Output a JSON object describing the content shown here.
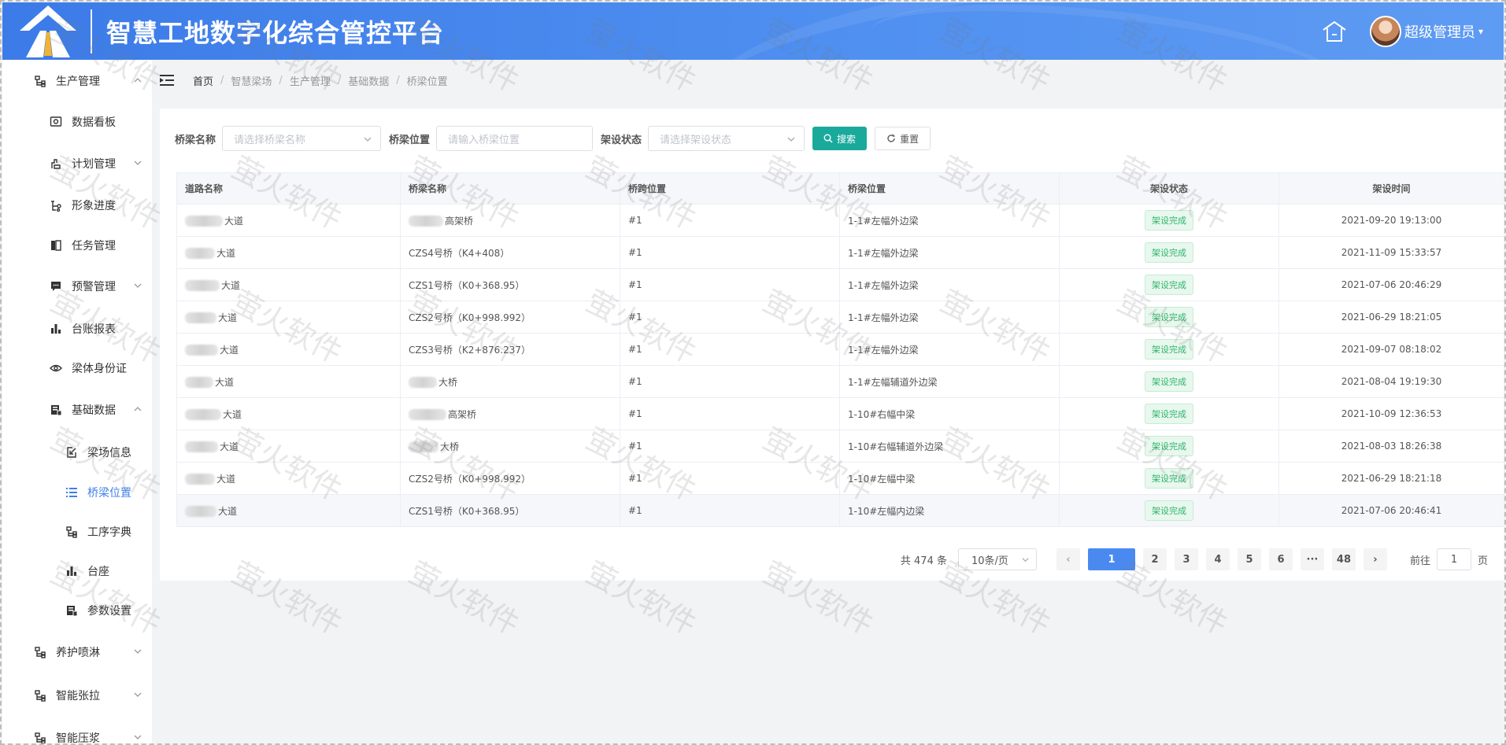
{
  "header": {
    "app_title": "智慧工地数字化综合管控平台",
    "username": "超级管理员",
    "icons": [
      "logo-road-icon",
      "home-icon",
      "caret-down-icon"
    ]
  },
  "sidebar": {
    "items": [
      {
        "label": "生产管理",
        "icon": "tree-icon"
      },
      {
        "label": "数据看板",
        "icon": "dashboard-icon"
      },
      {
        "label": "计划管理",
        "icon": "plan-icon"
      },
      {
        "label": "形象进度",
        "icon": "progress-icon"
      },
      {
        "label": "任务管理",
        "icon": "task-icon"
      },
      {
        "label": "预警管理",
        "icon": "alert-icon"
      },
      {
        "label": "台账报表",
        "icon": "chart-icon"
      },
      {
        "label": "梁体身份证",
        "icon": "eye-icon"
      },
      {
        "label": "基础数据",
        "icon": "database-icon"
      },
      {
        "label": "梁场信息",
        "icon": "info-icon"
      },
      {
        "label": "桥梁位置",
        "icon": "list-icon"
      },
      {
        "label": "工序字典",
        "icon": "tree-icon"
      },
      {
        "label": "台座",
        "icon": "chart-icon"
      },
      {
        "label": "参数设置",
        "icon": "settings-icon"
      },
      {
        "label": "养护喷淋",
        "icon": "tree-icon"
      },
      {
        "label": "智能张拉",
        "icon": "tree-icon"
      },
      {
        "label": "智能压浆",
        "icon": "tree-icon"
      }
    ]
  },
  "breadcrumb": {
    "items": [
      "首页",
      "智慧梁场",
      "生产管理",
      "基础数据",
      "桥梁位置"
    ],
    "separator": "/"
  },
  "filters": {
    "bridge_name_label": "桥梁名称",
    "bridge_name_placeholder": "请选择桥梁名称",
    "bridge_position_label": "桥梁位置",
    "bridge_position_placeholder": "请输入桥梁位置",
    "status_label": "架设状态",
    "status_placeholder": "请选择架设状态",
    "search_label": "搜索",
    "reset_label": "重置"
  },
  "table": {
    "columns": [
      "道路名称",
      "桥梁名称",
      "桥跨位置",
      "桥梁位置",
      "架设状态",
      "架设时间"
    ],
    "rows": [
      {
        "road": "大道",
        "bridge": "高架桥",
        "bridge_blur": true,
        "span": "#1",
        "position": "1-1#左幅外边梁",
        "status": "架设完成",
        "time": "2021-09-20 19:13:00"
      },
      {
        "road": "大道",
        "bridge": "CZS4号桥（K4+408）",
        "bridge_blur": false,
        "span": "#1",
        "position": "1-1#左幅外边梁",
        "status": "架设完成",
        "time": "2021-11-09 15:33:57"
      },
      {
        "road": "大道",
        "bridge": "CZS1号桥（K0+368.95）",
        "bridge_blur": false,
        "span": "#1",
        "position": "1-1#左幅外边梁",
        "status": "架设完成",
        "time": "2021-07-06 20:46:29"
      },
      {
        "road": "大道",
        "bridge": "CZS2号桥（K0+998.992）",
        "bridge_blur": false,
        "span": "#1",
        "position": "1-1#左幅外边梁",
        "status": "架设完成",
        "time": "2021-06-29 18:21:05"
      },
      {
        "road": "大道",
        "bridge": "CZS3号桥（K2+876.237）",
        "bridge_blur": false,
        "span": "#1",
        "position": "1-1#左幅外边梁",
        "status": "架设完成",
        "time": "2021-09-07 08:18:02"
      },
      {
        "road": "大道",
        "bridge": "大桥",
        "bridge_blur": true,
        "span": "#1",
        "position": "1-1#左幅辅道外边梁",
        "status": "架设完成",
        "time": "2021-08-04 19:19:30"
      },
      {
        "road": "大道",
        "bridge": "高架桥",
        "bridge_blur": true,
        "span": "#1",
        "position": "1-10#右幅中梁",
        "status": "架设完成",
        "time": "2021-10-09 12:36:53"
      },
      {
        "road": "大道",
        "bridge": "大桥",
        "bridge_blur": true,
        "span": "#1",
        "position": "1-10#右幅辅道外边梁",
        "status": "架设完成",
        "time": "2021-08-03 18:26:38"
      },
      {
        "road": "大道",
        "bridge": "CZS2号桥（K0+998.992）",
        "bridge_blur": false,
        "span": "#1",
        "position": "1-10#左幅中梁",
        "status": "架设完成",
        "time": "2021-06-29 18:21:18"
      },
      {
        "road": "大道",
        "bridge": "CZS1号桥（K0+368.95）",
        "bridge_blur": false,
        "span": "#1",
        "position": "1-10#左幅内边梁",
        "status": "架设完成",
        "time": "2021-07-06 20:46:41"
      }
    ]
  },
  "pagination": {
    "total_text": "共 474 条",
    "page_size": "10条/页",
    "pages": [
      "1",
      "2",
      "3",
      "4",
      "5",
      "6",
      "···",
      "48"
    ],
    "current_page": "1",
    "goto_label": "前往",
    "goto_value": "1",
    "page_suffix": "页"
  },
  "watermark": "萤火软件",
  "colors": {
    "header_blue": "#3c7be8",
    "accent_teal": "#1aaa9c",
    "active_blue": "#3f7fe8",
    "success_green": "#2fb36a"
  }
}
